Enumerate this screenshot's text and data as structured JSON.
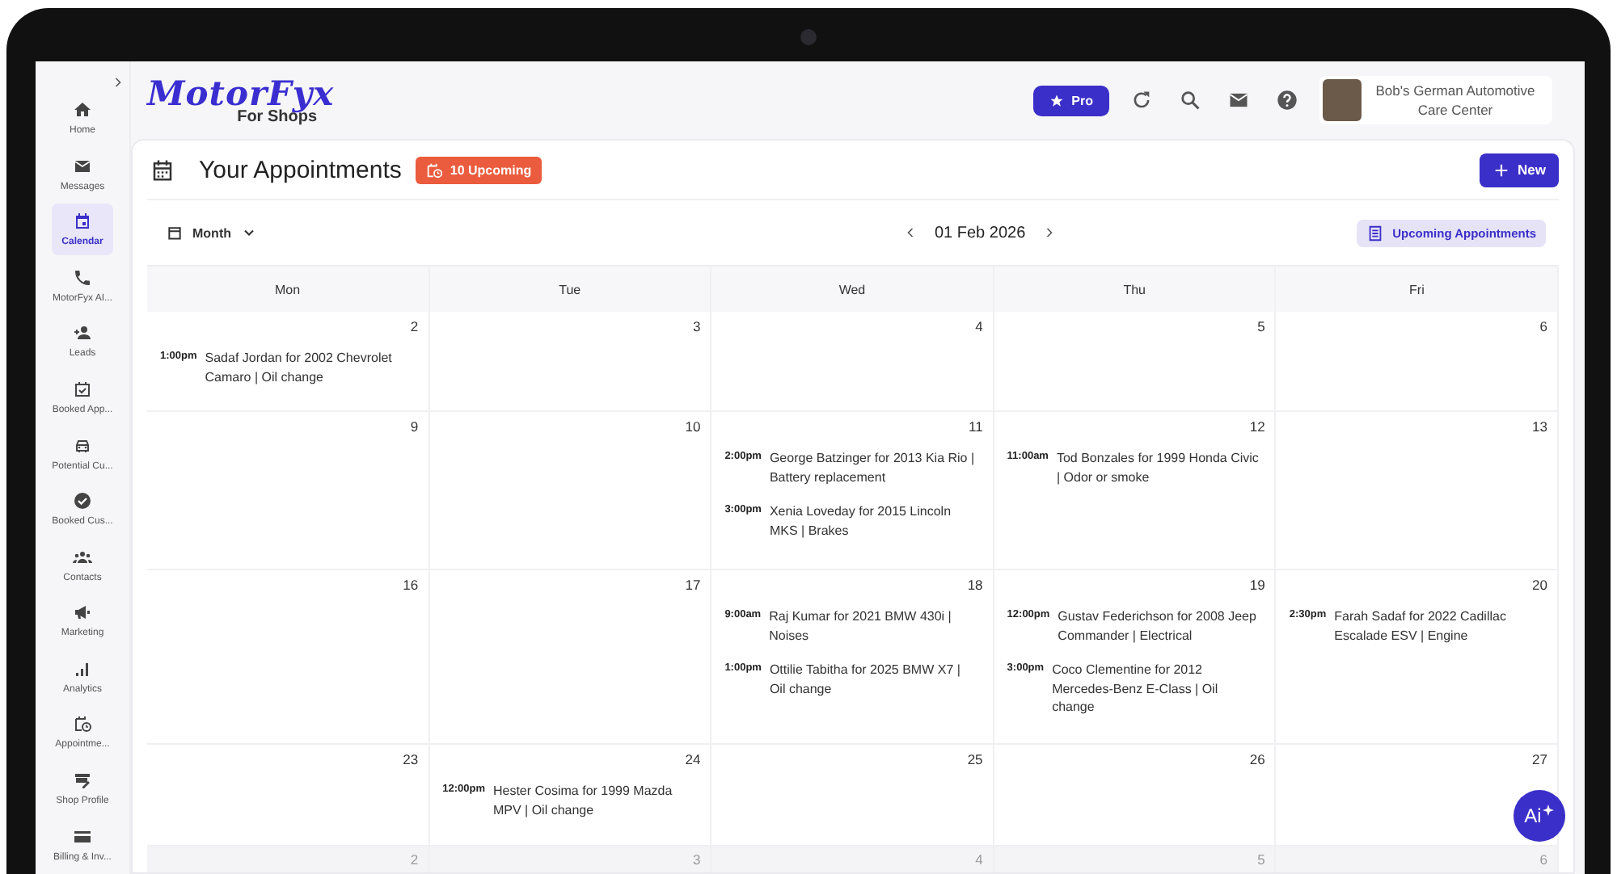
{
  "sidebar": {
    "items": [
      {
        "label": "Home",
        "selected": false
      },
      {
        "label": "Messages",
        "selected": false
      },
      {
        "label": "Calendar",
        "selected": true
      },
      {
        "label": "MotorFyx AI...",
        "selected": false
      },
      {
        "label": "Leads",
        "selected": false
      },
      {
        "label": "Booked App...",
        "selected": false
      },
      {
        "label": "Potential Cu...",
        "selected": false
      },
      {
        "label": "Booked Cus...",
        "selected": false
      },
      {
        "label": "Contacts",
        "selected": false
      },
      {
        "label": "Marketing",
        "selected": false
      },
      {
        "label": "Analytics",
        "selected": false
      },
      {
        "label": "Appointme...",
        "selected": false
      },
      {
        "label": "Shop Profile",
        "selected": false
      },
      {
        "label": "Billing & Inv...",
        "selected": false
      }
    ]
  },
  "header": {
    "logo": "MotorFyx",
    "logo_subtitle": "For Shops",
    "pro_button": "Pro",
    "shop_name": "Bob's German Automotive Care Center"
  },
  "page": {
    "title": "Your Appointments",
    "upcoming_badge": "10 Upcoming",
    "new_button": "New"
  },
  "toolbar": {
    "view": "Month",
    "date": "01 Feb 2026",
    "upcoming_button": "Upcoming Appointments"
  },
  "calendar": {
    "columns": [
      "Mon",
      "Tue",
      "Wed",
      "Thu",
      "Fri"
    ],
    "weeks": [
      {
        "days": [
          {
            "number": "2",
            "outside_month": false,
            "events": [
              {
                "time": "1:00pm",
                "text": "Sadaf Jordan for 2002 Chevrolet Camaro | Oil change"
              }
            ]
          },
          {
            "number": "3",
            "outside_month": false
          },
          {
            "number": "4",
            "outside_month": false
          },
          {
            "number": "5",
            "outside_month": false
          },
          {
            "number": "6",
            "outside_month": false
          }
        ]
      },
      {
        "days": [
          {
            "number": "9",
            "outside_month": false
          },
          {
            "number": "10",
            "outside_month": false
          },
          {
            "number": "11",
            "outside_month": false,
            "events": [
              {
                "time": "2:00pm",
                "text": "George Batzinger for 2013 Kia Rio | Battery replacement"
              },
              {
                "time": "3:00pm",
                "text": "Xenia Loveday for 2015 Lincoln MKS | Brakes"
              }
            ]
          },
          {
            "number": "12",
            "outside_month": false,
            "events": [
              {
                "time": "11:00am",
                "text": "Tod Bonzales for 1999 Honda Civic | Odor or smoke"
              }
            ]
          },
          {
            "number": "13",
            "outside_month": false
          }
        ]
      },
      {
        "days": [
          {
            "number": "16",
            "outside_month": false
          },
          {
            "number": "17",
            "outside_month": false
          },
          {
            "number": "18",
            "outside_month": false,
            "events": [
              {
                "time": "9:00am",
                "text": "Raj Kumar for 2021 BMW 430i | Noises"
              },
              {
                "time": "1:00pm",
                "text": "Ottilie Tabitha for 2025 BMW X7 | Oil change"
              }
            ]
          },
          {
            "number": "19",
            "outside_month": false,
            "events": [
              {
                "time": "12:00pm",
                "text": "Gustav Federichson for 2008 Jeep Commander | Electrical"
              },
              {
                "time": "3:00pm",
                "text": "Coco Clementine for 2012 Mercedes-Benz E-Class | Oil change"
              }
            ]
          },
          {
            "number": "20",
            "outside_month": false,
            "events": [
              {
                "time": "2:30pm",
                "text": "Farah Sadaf for 2022 Cadillac Escalade ESV | Engine"
              }
            ]
          }
        ]
      },
      {
        "days": [
          {
            "number": "23",
            "outside_month": false
          },
          {
            "number": "24",
            "outside_month": false,
            "events": [
              {
                "time": "12:00pm",
                "text": "Hester Cosima for 1999 Mazda MPV | Oil change"
              }
            ]
          },
          {
            "number": "25",
            "outside_month": false
          },
          {
            "number": "26",
            "outside_month": false
          },
          {
            "number": "27",
            "outside_month": false
          }
        ]
      },
      {
        "days": [
          {
            "number": "2",
            "outside_month": true
          },
          {
            "number": "3",
            "outside_month": true
          },
          {
            "number": "4",
            "outside_month": true
          },
          {
            "number": "5",
            "outside_month": true
          },
          {
            "number": "6",
            "outside_month": true
          }
        ]
      }
    ]
  },
  "ai_button": {
    "label": "Ai"
  }
}
